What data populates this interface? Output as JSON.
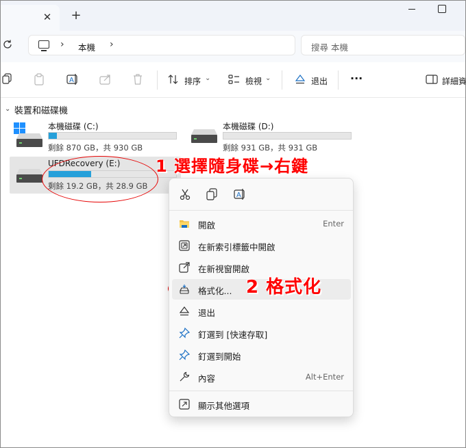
{
  "titlebar": {
    "tab_close": "✕",
    "new_tab": "+"
  },
  "address": {
    "crumb": "本機",
    "sep": "›"
  },
  "search": {
    "placeholder": "搜尋 本機"
  },
  "toolbar": {
    "sort_label": "排序",
    "view_label": "檢視",
    "eject_label": "退出",
    "more": "···",
    "details_label": "詳細資"
  },
  "section": {
    "title": "裝置和磁碟機",
    "chev": "⌄"
  },
  "drives": [
    {
      "name": "本機磁碟 (C:)",
      "free_text": "剩餘 870 GB，共 930 GB",
      "used_fraction": 0.065
    },
    {
      "name": "本機磁碟 (D:)",
      "free_text": "剩餘 931 GB，共 931 GB",
      "used_fraction": 0.0
    },
    {
      "name": "UFDRecovery (E:)",
      "free_text": "剩餘 19.2 GB，共 28.9 GB",
      "used_fraction": 0.335
    }
  ],
  "annotations": {
    "step1": "1 選擇隨身碟→右鍵",
    "step2": "2 格式化"
  },
  "context_menu": {
    "items": [
      {
        "label": "開啟",
        "shortcut": "Enter"
      },
      {
        "label": "在新索引標籤中開啟",
        "shortcut": ""
      },
      {
        "label": "在新視窗開啟",
        "shortcut": ""
      },
      {
        "label": "格式化...",
        "shortcut": ""
      },
      {
        "label": "退出",
        "shortcut": ""
      },
      {
        "label": "釘選到 [快速存取]",
        "shortcut": ""
      },
      {
        "label": "釘選到開始",
        "shortcut": ""
      },
      {
        "label": "內容",
        "shortcut": "Alt+Enter"
      },
      {
        "label": "顯示其他選項",
        "shortcut": ""
      }
    ]
  },
  "colors": {
    "accent": "#26a0da",
    "annotation": "#ff0000"
  }
}
